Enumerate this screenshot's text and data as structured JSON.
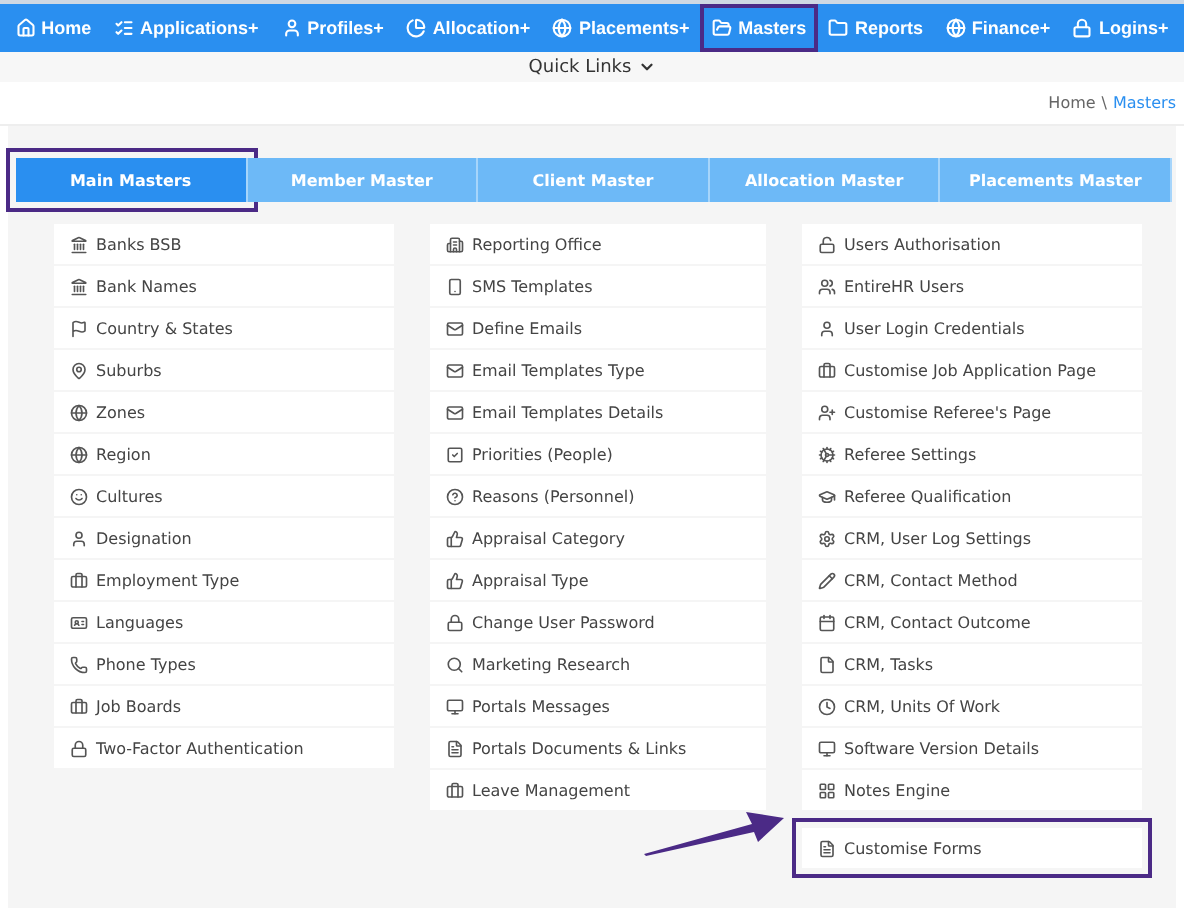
{
  "nav": [
    {
      "label": "Home",
      "highlighted": false
    },
    {
      "label": "Applications+",
      "highlighted": false
    },
    {
      "label": "Profiles+",
      "highlighted": false
    },
    {
      "label": "Allocation+",
      "highlighted": false
    },
    {
      "label": "Placements+",
      "highlighted": false
    },
    {
      "label": "Masters",
      "highlighted": true
    },
    {
      "label": "Reports",
      "highlighted": false
    },
    {
      "label": "Finance+",
      "highlighted": false
    },
    {
      "label": "Logins+",
      "highlighted": false
    }
  ],
  "quick_links": "Quick Links",
  "breadcrumb": {
    "home": "Home",
    "separator": "\\",
    "current": "Masters"
  },
  "tabs": [
    {
      "label": "Main Masters",
      "selected": true,
      "highlighted": true
    },
    {
      "label": "Member Master",
      "selected": false,
      "highlighted": false
    },
    {
      "label": "Client Master",
      "selected": false,
      "highlighted": false
    },
    {
      "label": "Allocation Master",
      "selected": false,
      "highlighted": false
    },
    {
      "label": "Placements Master",
      "selected": false,
      "highlighted": false
    }
  ],
  "columns": [
    [
      {
        "label": "Banks BSB"
      },
      {
        "label": "Bank Names"
      },
      {
        "label": "Country & States"
      },
      {
        "label": "Suburbs"
      },
      {
        "label": "Zones"
      },
      {
        "label": "Region"
      },
      {
        "label": "Cultures"
      },
      {
        "label": "Designation"
      },
      {
        "label": "Employment Type"
      },
      {
        "label": "Languages"
      },
      {
        "label": "Phone Types"
      },
      {
        "label": "Job Boards"
      },
      {
        "label": "Two-Factor Authentication"
      }
    ],
    [
      {
        "label": "Reporting Office"
      },
      {
        "label": "SMS Templates"
      },
      {
        "label": "Define Emails"
      },
      {
        "label": "Email Templates Type"
      },
      {
        "label": "Email Templates Details"
      },
      {
        "label": "Priorities (People)"
      },
      {
        "label": "Reasons (Personnel)"
      },
      {
        "label": "Appraisal Category"
      },
      {
        "label": "Appraisal Type"
      },
      {
        "label": "Change User Password"
      },
      {
        "label": "Marketing Research"
      },
      {
        "label": "Portals Messages"
      },
      {
        "label": "Portals Documents & Links"
      },
      {
        "label": "Leave Management"
      }
    ],
    [
      {
        "label": "Users Authorisation"
      },
      {
        "label": "EntireHR Users"
      },
      {
        "label": "User Login Credentials"
      },
      {
        "label": "Customise Job Application Page"
      },
      {
        "label": "Customise Referee's Page"
      },
      {
        "label": "Referee Settings"
      },
      {
        "label": "Referee Qualification"
      },
      {
        "label": "CRM, User Log Settings"
      },
      {
        "label": "CRM, Contact Method"
      },
      {
        "label": "CRM, Contact Outcome"
      },
      {
        "label": "CRM, Tasks"
      },
      {
        "label": "CRM, Units Of Work"
      },
      {
        "label": "Software Version Details"
      },
      {
        "label": "Notes Engine"
      },
      {
        "label": "Customise Forms",
        "highlighted": true
      }
    ]
  ]
}
